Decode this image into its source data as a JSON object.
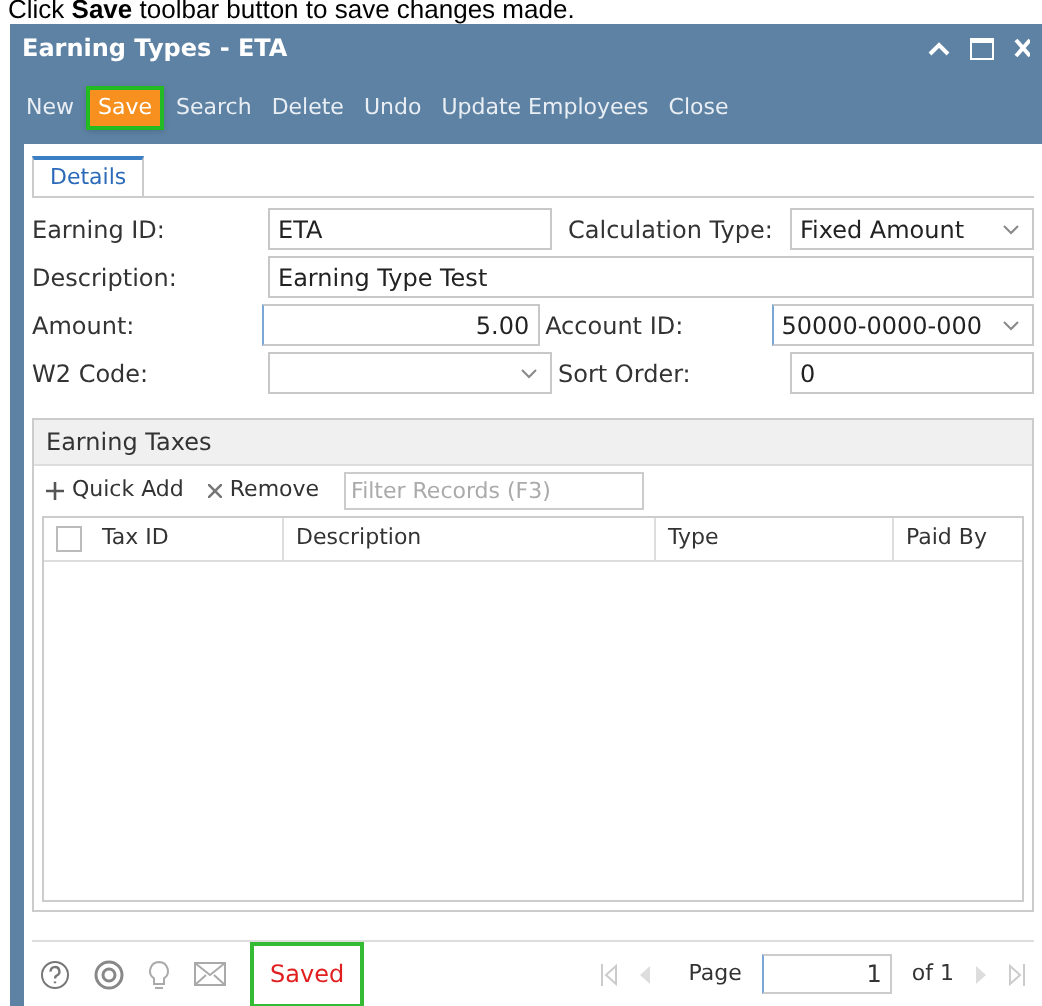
{
  "caption": "Click **Save** toolbar button to save changes made.",
  "window": {
    "title": "Earning Types - ETA"
  },
  "toolbar": [
    {
      "label": "New",
      "selected": false
    },
    {
      "label": "Save",
      "selected": true
    },
    {
      "label": "Search",
      "selected": false
    },
    {
      "label": "Delete",
      "selected": false
    },
    {
      "label": "Undo",
      "selected": false
    },
    {
      "label": "Update Employees",
      "selected": false
    },
    {
      "label": "Close",
      "selected": false
    }
  ],
  "tabs": [
    {
      "label": "Details",
      "selected": true
    }
  ],
  "form": {
    "earning_id": {
      "label": "Earning ID:",
      "value": "ETA"
    },
    "calculation_type": {
      "label": "Calculation Type:",
      "value": "Fixed Amount"
    },
    "description": {
      "label": "Description:",
      "value": "Earning Type Test"
    },
    "amount": {
      "label": "Amount:",
      "value": "5.00"
    },
    "account_id": {
      "label": "Account ID:",
      "value": "50000-0000-000"
    },
    "w2_code": {
      "label": "W2 Code:"
    },
    "sort_order": {
      "label": "Sort Order:",
      "value": "0"
    }
  },
  "earning_taxes": {
    "title": "Earning Taxes",
    "quick_add": "Quick Add",
    "remove": "Remove",
    "filter_placeholder": "Filter Records (F3)",
    "columns": [
      "Tax ID",
      "Description",
      "Type",
      "Paid By"
    ],
    "select_all_checked": false
  },
  "status_bar": {
    "status": "Saved",
    "page_label": "Page",
    "page": "1",
    "of": "of 1"
  }
}
